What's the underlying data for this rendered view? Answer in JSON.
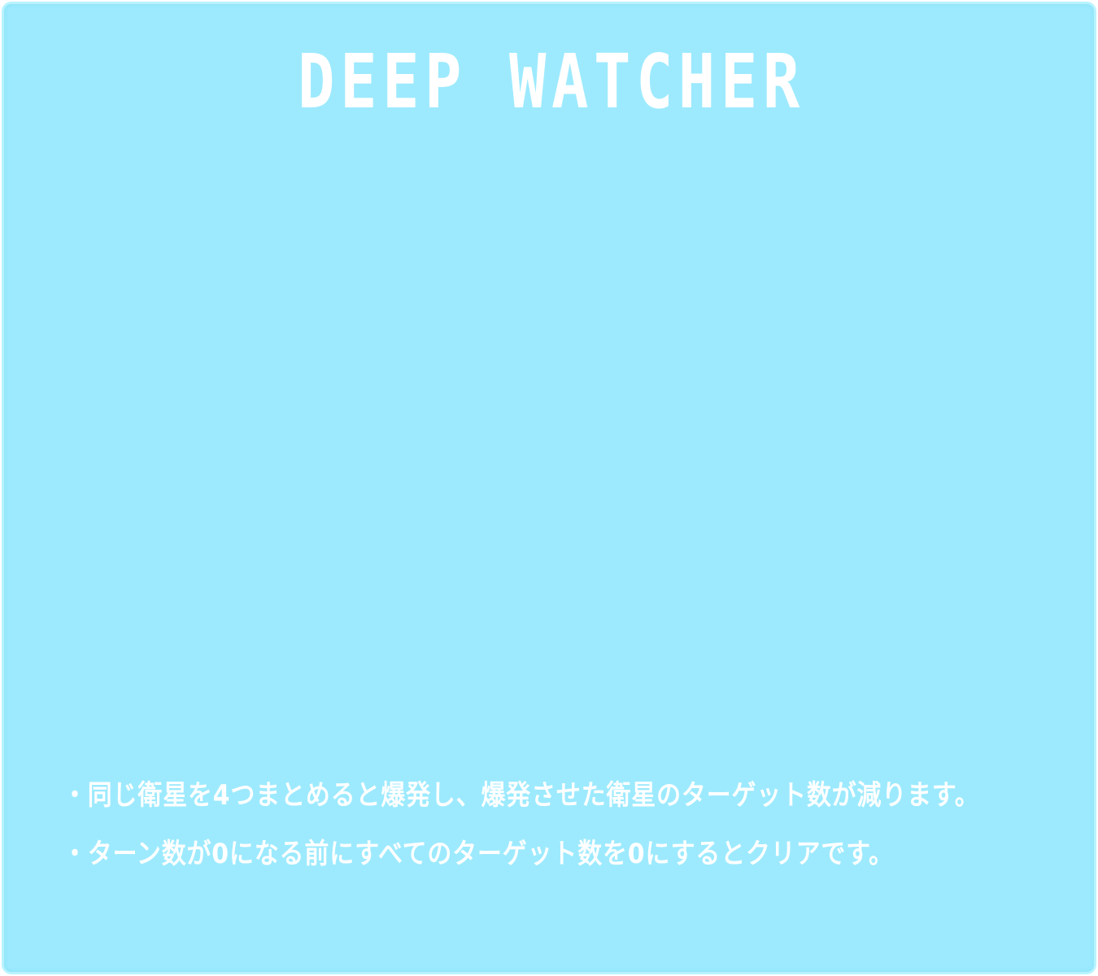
{
  "game": {
    "title": "DEEP WATCHER",
    "rules": [
      "・同じ衛星を4つまとめると爆発し、爆発させた衛星のターゲット数が減ります。",
      "・ターン数が0になる前にすべてのターゲット数を0にするとクリアです。"
    ],
    "colors": {
      "panel_background": "#9deafe",
      "panel_border": "#b8f3ff",
      "text": "#ffffff"
    }
  }
}
